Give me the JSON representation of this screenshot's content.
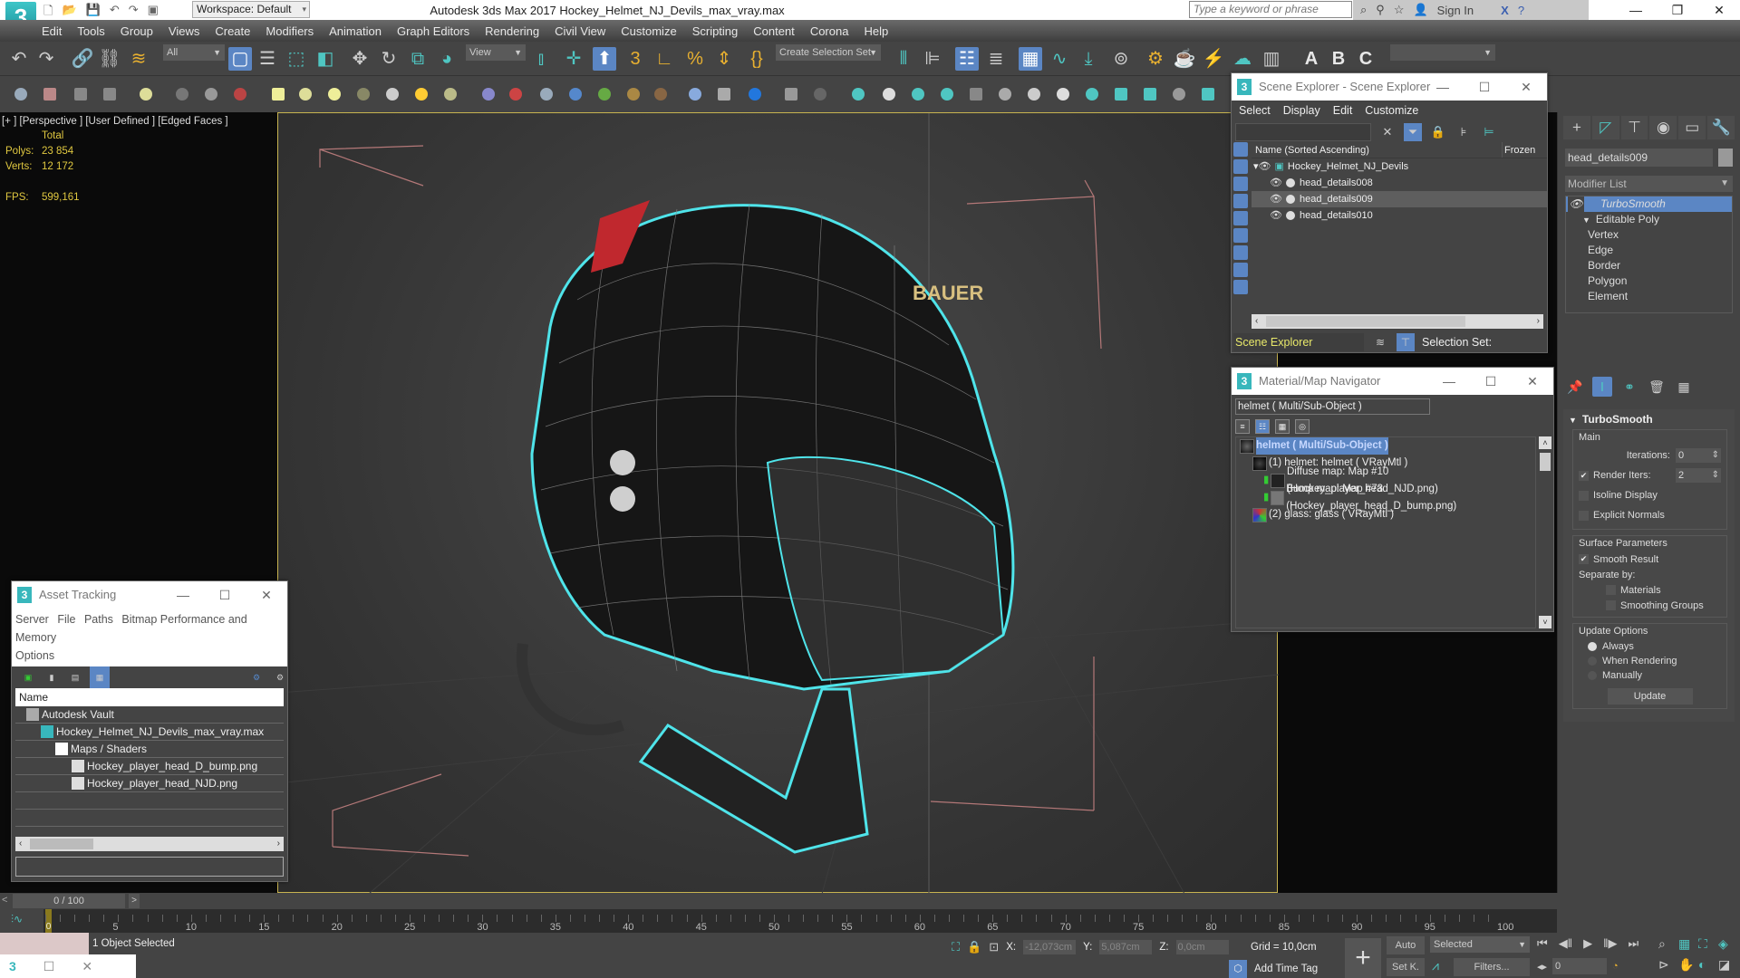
{
  "app": {
    "logo_text": "3",
    "workspace": "Workspace: Default",
    "title": "Autodesk 3ds Max 2017      Hockey_Helmet_NJ_Devils_max_vray.max",
    "search_placeholder": "Type a keyword or phrase",
    "sign_in": "Sign In",
    "win_min": "—",
    "win_max": "❐",
    "win_close": "✕"
  },
  "menu": [
    "Edit",
    "Tools",
    "Group",
    "Views",
    "Create",
    "Modifiers",
    "Animation",
    "Graph Editors",
    "Rendering",
    "Civil View",
    "Customize",
    "Scripting",
    "Content",
    "Corona",
    "Help"
  ],
  "toolbar": {
    "selection_filter": "All",
    "ref_coord": "View",
    "selection_set": "Create Selection Set",
    "tooltip": "Undo"
  },
  "viewport": {
    "label": "[+ ] [Perspective ]  [User Defined ] [Edged Faces ]",
    "stats_header": "Total",
    "stats": [
      {
        "key": "Polys:",
        "value": "23 854"
      },
      {
        "key": "Verts:",
        "value": "12 172"
      },
      {
        "key": "FPS:",
        "value": "599,161"
      }
    ]
  },
  "scene_explorer": {
    "title": "Scene Explorer - Scene Explorer",
    "menu": [
      "Select",
      "Display",
      "Edit",
      "Customize"
    ],
    "col_name": "Name (Sorted Ascending)",
    "col_frozen": "Frozen",
    "root": "Hockey_Helmet_NJ_Devils",
    "children": [
      {
        "name": "head_details008",
        "selected": false
      },
      {
        "name": "head_details009",
        "selected": true
      },
      {
        "name": "head_details010",
        "selected": false
      }
    ],
    "footer_explorer": "Scene Explorer",
    "footer_selset": "Selection Set:"
  },
  "material_navigator": {
    "title": "Material/Map Navigator",
    "current": "helmet  ( Multi/Sub-Object )",
    "items": [
      {
        "label": "helmet  ( Multi/Sub-Object )",
        "level": 0,
        "highlight": true
      },
      {
        "label": "(1) helmet: helmet  ( VRayMtl )",
        "level": 1,
        "highlight": false
      },
      {
        "label": "Diffuse map: Map #10 (Hockey_player_head_NJD.png)",
        "level": 2,
        "highlight": false
      },
      {
        "label": "Bump map: Map #73 (Hockey_player_head_D_bump.png)",
        "level": 2,
        "highlight": false
      },
      {
        "label": "(2) glass: glass  ( VRayMtl )",
        "level": 1,
        "highlight": false
      }
    ]
  },
  "asset_tracking": {
    "title": "Asset Tracking",
    "menu_line1": [
      "Server",
      "File",
      "Paths",
      "Bitmap Performance and Memory"
    ],
    "menu_line2": [
      "Options"
    ],
    "col_name": "Name",
    "rows": [
      {
        "label": "Autodesk Vault",
        "level": 0
      },
      {
        "label": "Hockey_Helmet_NJ_Devils_max_vray.max",
        "level": 1
      },
      {
        "label": "Maps / Shaders",
        "level": 2
      },
      {
        "label": "Hockey_player_head_D_bump.png",
        "level": 3
      },
      {
        "label": "Hockey_player_head_NJD.png",
        "level": 3
      }
    ]
  },
  "command_panel": {
    "object_name": "head_details009",
    "modifier_list": "Modifier List",
    "stack": [
      {
        "label": "TurboSmooth",
        "selected": true
      },
      {
        "label": "Editable Poly",
        "selected": false
      },
      {
        "label": "Vertex",
        "selected": false
      },
      {
        "label": "Edge",
        "selected": false
      },
      {
        "label": "Border",
        "selected": false
      },
      {
        "label": "Polygon",
        "selected": false
      },
      {
        "label": "Element",
        "selected": false
      }
    ],
    "rollout_title": "TurboSmooth",
    "main_group": "Main",
    "iterations_label": "Iterations:",
    "iterations_value": "0",
    "render_iters_label": "Render Iters:",
    "render_iters_value": "2",
    "render_iters_checked": true,
    "isoline_label": "Isoline Display",
    "explicit_normals_label": "Explicit Normals",
    "surface_group": "Surface Parameters",
    "smooth_result_label": "Smooth Result",
    "separate_by_label": "Separate by:",
    "materials_label": "Materials",
    "smoothing_groups_label": "Smoothing Groups",
    "update_group": "Update Options",
    "update_always": "Always",
    "update_rendering": "When Rendering",
    "update_manually": "Manually",
    "update_button": "Update"
  },
  "timeline": {
    "frame_display": "0 / 100",
    "current_frame": "0",
    "ticks": [
      "0",
      "5",
      "10",
      "15",
      "20",
      "25",
      "30",
      "35",
      "40",
      "45",
      "50",
      "55",
      "60",
      "65",
      "70",
      "75",
      "80",
      "85",
      "90",
      "95",
      "100"
    ]
  },
  "status": {
    "selection": "1 Object Selected",
    "x_label": "X:",
    "x_value": "-12,073cm",
    "y_label": "Y:",
    "y_value": "5,087cm",
    "z_label": "Z:",
    "z_value": "0,0cm",
    "grid": "Grid = 10,0cm",
    "add_time_tag": "Add Time Tag",
    "auto": "Auto",
    "set_key": "Set K.",
    "key_filter": "Selected",
    "filters": "Filters...",
    "frame_value": "0"
  }
}
